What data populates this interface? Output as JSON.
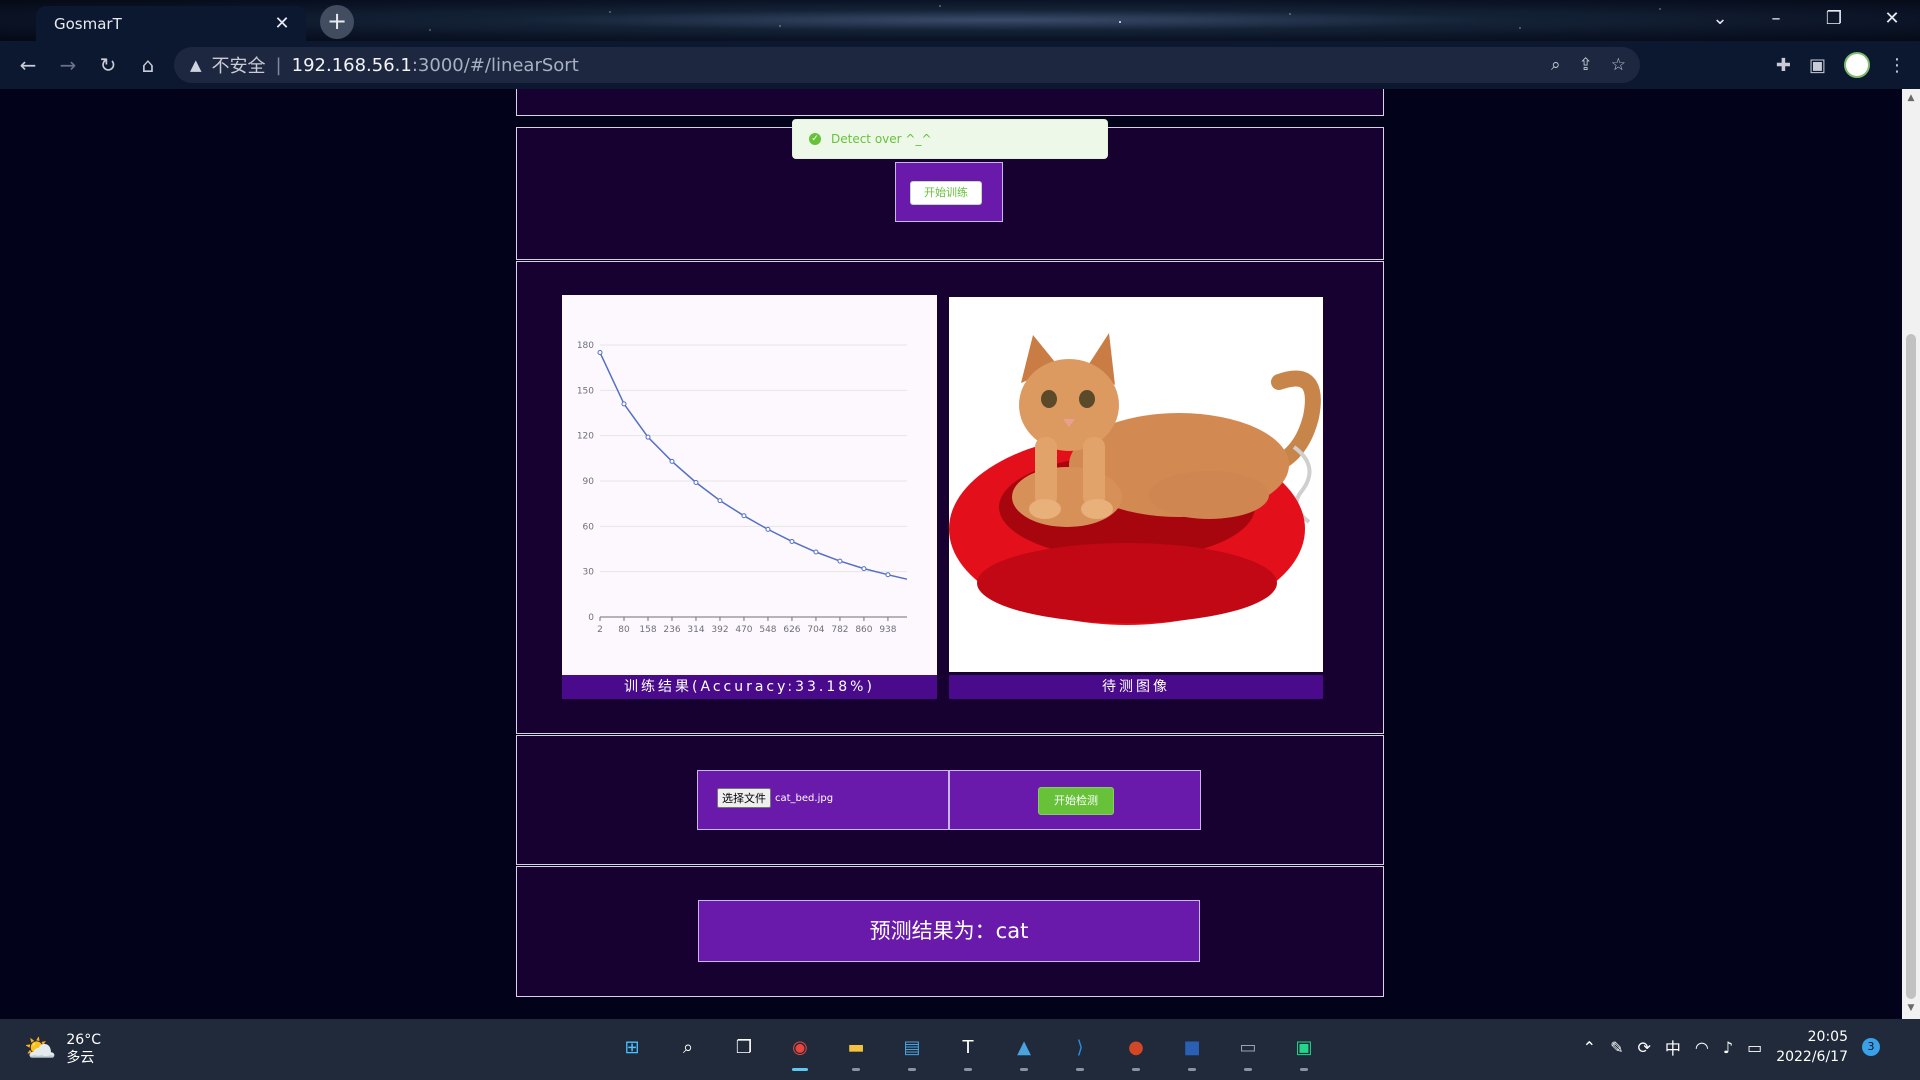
{
  "browser": {
    "tab_title": "GosmarT",
    "insecure_label": "不安全",
    "separator": "|",
    "url_host": "192.168.56.1",
    "url_path": ":3000/#/linearSort",
    "new_tab": "+",
    "close_tab": "✕"
  },
  "toast": {
    "text": "Detect over ^_^"
  },
  "train": {
    "button_label": "开始训练"
  },
  "chart_caption": "训练结果(Accuracy:33.18%)",
  "image_caption": "待测图像",
  "upload": {
    "choose_label": "选择文件",
    "file_name": "cat_bed.jpg",
    "detect_label": "开始检测"
  },
  "result": {
    "text": "预测结果为：cat"
  },
  "chart_data": {
    "type": "line",
    "title": "",
    "xlabel": "",
    "ylabel": "",
    "x_ticks": [
      "2",
      "80",
      "158",
      "236",
      "314",
      "392",
      "470",
      "548",
      "626",
      "704",
      "782",
      "860",
      "938"
    ],
    "y_ticks": [
      "0",
      "30",
      "60",
      "90",
      "120",
      "150",
      "180"
    ],
    "ylim": [
      0,
      180
    ],
    "xlim": [
      2,
      1000
    ],
    "grid": true,
    "color": "#5470c6",
    "series": [
      {
        "x": [
          2,
          80,
          158,
          236,
          314,
          392,
          470,
          548,
          626,
          704,
          782,
          860,
          938,
          1000
        ],
        "values": [
          175,
          141,
          119,
          103,
          89,
          77,
          67,
          58,
          50,
          43,
          37,
          32,
          28,
          25
        ]
      }
    ]
  },
  "taskbar": {
    "temperature": "26°C",
    "weather": "多云",
    "time": "20:05",
    "date": "2022/6/17",
    "ime": "中",
    "notifications": "3"
  },
  "colors": {
    "panel": "#170130",
    "accent_purple": "#6a1aab",
    "success_green": "#67c23a"
  }
}
